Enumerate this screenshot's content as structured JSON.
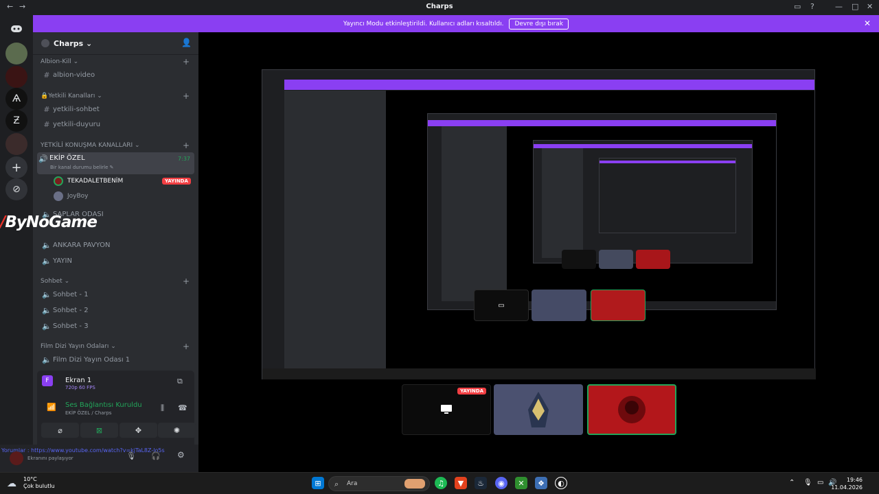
{
  "window": {
    "title": "Charps"
  },
  "notice": {
    "text": "Yayıncı Modu etkinleştirildi. Kullanıcı adları kısaltıldı.",
    "button": "Devre dışı bırak"
  },
  "server": {
    "name": "Charps ⌄"
  },
  "sidebar": {
    "cat1": "Albion-Kill ⌄",
    "ch_albion_video": "albion-video",
    "cat2": "🔒Yetkili Kanalları ⌄",
    "ch_yetkili_sohbet": "yetkili-sohbet",
    "ch_yetkili_duyuru": "yetkili-duyuru",
    "cat3": "YETKİLİ KONUŞMA KANALLARI ⌄",
    "active_channel": "EKİP ÖZEL",
    "active_status": "Bir kanal durumu belirle ✎",
    "active_time": "7:37",
    "member1": "TEKADALETBENİM",
    "member1_badge": "YAYINDA",
    "member2": "JoyBoy",
    "ch_saplar": "SAPLAR ODASI",
    "ch_ankara": "ANKARA PAVYON",
    "ch_yayin": "YAYIN",
    "cat4": "Sohbet ⌄",
    "ch_sohbet1": "Sohbet - 1",
    "ch_sohbet2": "Sohbet - 2",
    "ch_sohbet3": "Sohbet - 3",
    "cat5": "Film Dizi Yayın Odaları ⌄",
    "ch_film": "Film Dizi Yayın Odası 1"
  },
  "overlay_logo": "ByNoGame",
  "voice_panel": {
    "stream_title": "Ekran 1",
    "stream_quality": "720p 60 FPS",
    "connection": "Ses Bağlantısı Kuruldu",
    "connection_sub": "EKİP ÖZEL / Charps"
  },
  "userbar": {
    "link": "Yorumlar : https://www.youtube.com/watch?v=kjTaL8Z-lo5s",
    "status": "Ekranını paylaşıyor"
  },
  "stream_tiles": {
    "live_badge": "YAYINDA"
  },
  "taskbar": {
    "temp": "10°C",
    "weather": "Çok bulutlu",
    "search": "Ara",
    "time": "19:46",
    "date": "11.04.2026"
  },
  "colors": {
    "accent": "#8a3ff2",
    "live": "#f23f43",
    "online": "#23a55a"
  }
}
